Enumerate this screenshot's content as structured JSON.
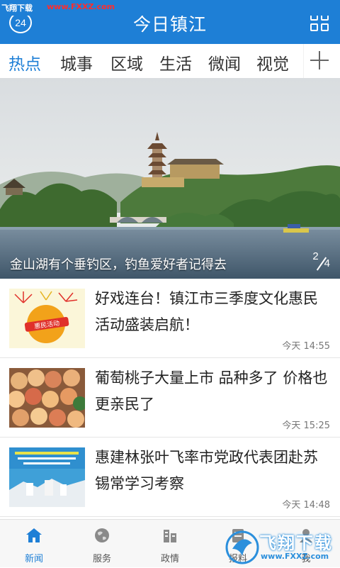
{
  "watermark": {
    "top_site_label": "飞翔下载",
    "top_url": "www.FXXZ.com",
    "badge_text": "飞翔下载",
    "badge_url": "www.FXXZ.com"
  },
  "header": {
    "badge_number": "24",
    "title": "今日镇江"
  },
  "tabs": [
    {
      "label": "热点",
      "active": true
    },
    {
      "label": "城事"
    },
    {
      "label": "区域"
    },
    {
      "label": "生活"
    },
    {
      "label": "微闻"
    },
    {
      "label": "视觉"
    }
  ],
  "hero": {
    "caption": "金山湖有个垂钓区，钓鱼爱好者记得去",
    "page_current": "2",
    "page_total": "4"
  },
  "news": [
    {
      "title": "好戏连台！镇江市三季度文化惠民活动盛装启航！",
      "time": "今天 14:55",
      "thumb_label": "惠民活动"
    },
    {
      "title": "葡萄桃子大量上市  品种多了 价格也更亲民了",
      "time": "今天 15:25"
    },
    {
      "title": "惠建林张叶飞率市党政代表团赴苏锡常学习考察",
      "time": "今天 14:48"
    }
  ],
  "bottom_nav": [
    {
      "label": "新闻",
      "icon": "home-icon",
      "active": true
    },
    {
      "label": "服务",
      "icon": "globe-icon"
    },
    {
      "label": "政情",
      "icon": "building-icon"
    },
    {
      "label": "报料",
      "icon": "report-icon"
    },
    {
      "label": "我",
      "icon": "user-icon"
    }
  ],
  "colors": {
    "accent": "#1e7fd6"
  }
}
